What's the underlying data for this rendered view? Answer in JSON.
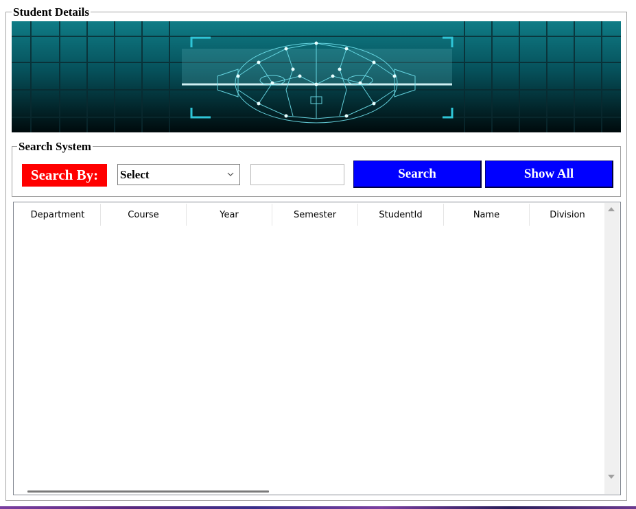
{
  "frame": {
    "title": "Student Details"
  },
  "search": {
    "title": "Search System",
    "label": "Search By:",
    "select_value": "Select",
    "text_value": "",
    "search_button": "Search",
    "showall_button": "Show All"
  },
  "table": {
    "columns": [
      "Department",
      "Course",
      "Year",
      "Semester",
      "StudentId",
      "Name",
      "Division"
    ],
    "rows": []
  },
  "colors": {
    "label_bg": "#ff0000",
    "button_bg": "#0000ff",
    "banner_bg": "#003c44"
  },
  "icons": [
    "chevron-down-icon",
    "scroll-up-icon",
    "scroll-down-icon",
    "face-scan-icon"
  ]
}
